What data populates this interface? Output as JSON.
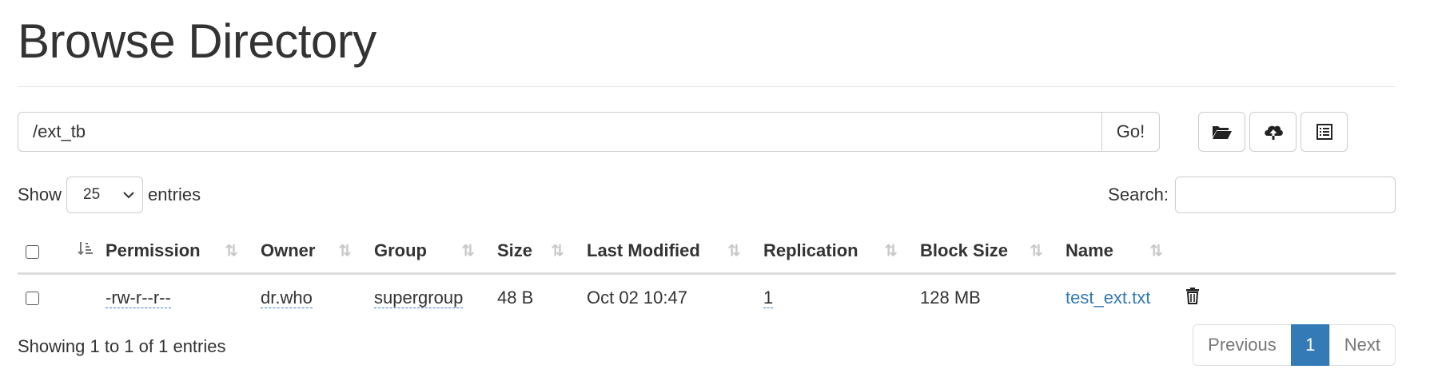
{
  "page": {
    "title": "Browse Directory"
  },
  "pathbar": {
    "path_value": "/ext_tb",
    "go_label": "Go!"
  },
  "toolbar": {
    "icons": [
      "folder-open-icon",
      "cloud-upload-icon",
      "list-alt-icon"
    ]
  },
  "length": {
    "show_label": "Show",
    "selected": "25",
    "entries_label": "entries"
  },
  "search": {
    "label": "Search:",
    "value": ""
  },
  "table": {
    "columns": [
      "Permission",
      "Owner",
      "Group",
      "Size",
      "Last Modified",
      "Replication",
      "Block Size",
      "Name"
    ],
    "rows": [
      {
        "permission": "-rw-r--r--",
        "owner": "dr.who",
        "group": "supergroup",
        "size": "48 B",
        "last_modified": "Oct 02 10:47",
        "replication": "1",
        "block_size": "128 MB",
        "name": "test_ext.txt"
      }
    ]
  },
  "footer": {
    "info": "Showing 1 to 1 of 1 entries",
    "previous_label": "Previous",
    "current_page": "1",
    "next_label": "Next"
  },
  "colors": {
    "accent": "#337ab7",
    "text": "#333333",
    "border": "#dddddd"
  }
}
